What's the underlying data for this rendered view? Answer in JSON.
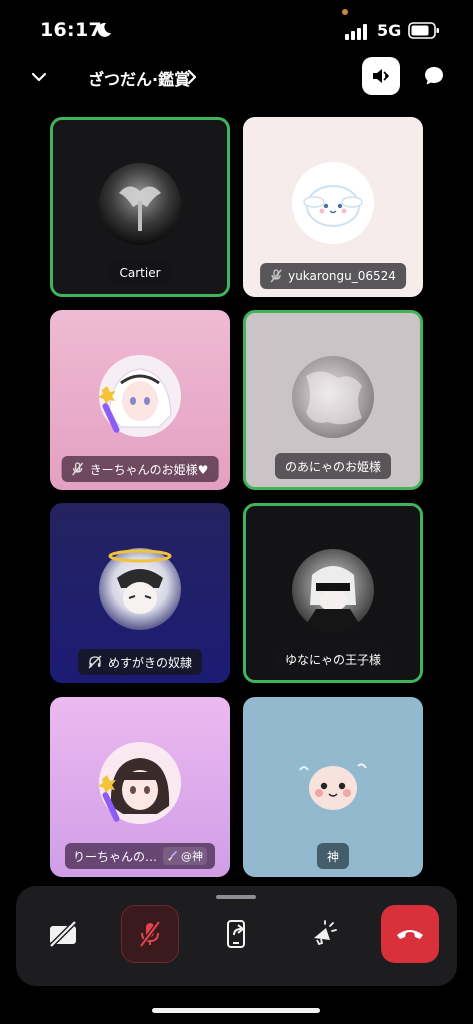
{
  "status": {
    "time": "16:17",
    "network": "5G"
  },
  "header": {
    "title": "ざつだん·鑑賞"
  },
  "participants": [
    {
      "name": "Cartier",
      "speaking": true,
      "muted": false,
      "bg": "#161618"
    },
    {
      "name": "yukarongu_06524",
      "speaking": false,
      "muted": true,
      "bg": "#f7ecec"
    },
    {
      "name": "きーちゃんのお姫様♥",
      "speaking": false,
      "muted": true,
      "bg": "#e8a9c8"
    },
    {
      "name": "のあにゃのお姫様",
      "speaking": true,
      "muted": false,
      "bg": "#cbc4c6"
    },
    {
      "name": "めすがきの奴隷",
      "speaking": false,
      "muted": true,
      "bg": "#1e1d62"
    },
    {
      "name": "ゆなにゃの王子様",
      "speaking": true,
      "muted": false,
      "bg": "#131315"
    },
    {
      "name": "りーちゃんの…",
      "tag": "@神",
      "speaking": false,
      "muted": false,
      "bg": "#d8a8ec"
    },
    {
      "name": "神",
      "speaking": false,
      "muted": false,
      "bg": "#93b9cf"
    }
  ],
  "call_controls": {
    "icons": [
      "camera-off-icon",
      "mic-off-icon",
      "screen-share-icon",
      "soundboard-icon",
      "hang-up-icon"
    ],
    "colors": {
      "leave": "#d8313c",
      "speaking_border": "#3fb45d"
    }
  }
}
